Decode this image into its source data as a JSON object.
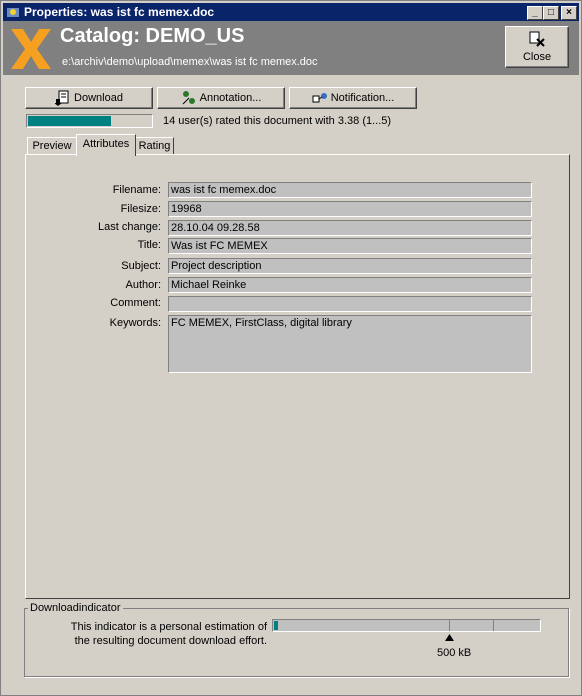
{
  "window": {
    "title": "Properties: was ist fc memex.doc"
  },
  "header": {
    "catalog_title": "Catalog: DEMO_US",
    "path": "e:\\archiv\\demo\\upload\\memex\\was ist fc memex.doc",
    "close_label": "Close"
  },
  "toolbar": {
    "download_label": "Download",
    "annotation_label": "Annotation...",
    "notification_label": "Notification..."
  },
  "rating": {
    "summary": "14 user(s) rated this document with  3.38 (1...5)",
    "fraction": 0.676
  },
  "tabs": [
    {
      "label": "Preview",
      "active": false
    },
    {
      "label": "Attributes",
      "active": true
    },
    {
      "label": "Rating",
      "active": false
    }
  ],
  "attributes": {
    "filename_label": "Filename:",
    "filename": "was ist fc memex.doc",
    "filesize_label": "Filesize:",
    "filesize": "19968",
    "lastchange_label": "Last change:",
    "lastchange": "28.10.04 09.28.58",
    "title_label": "Title:",
    "title": "Was ist FC MEMEX",
    "subject_label": "Subject:",
    "subject": "Project description",
    "author_label": "Author:",
    "author": "Michael Reinke",
    "comment_label": "Comment:",
    "comment": "",
    "keywords_label": "Keywords:",
    "keywords": "FC MEMEX, FirstClass, digital library"
  },
  "download_indicator": {
    "group_title": "Downloadindicator",
    "description_line1": "This indicator is a personal estimation of",
    "description_line2": "the resulting document download effort.",
    "marker_label": "500 kB"
  },
  "colors": {
    "titlebar": "#0a246a",
    "header": "#808080",
    "logo": "#f5a020",
    "accent": "#008080"
  }
}
